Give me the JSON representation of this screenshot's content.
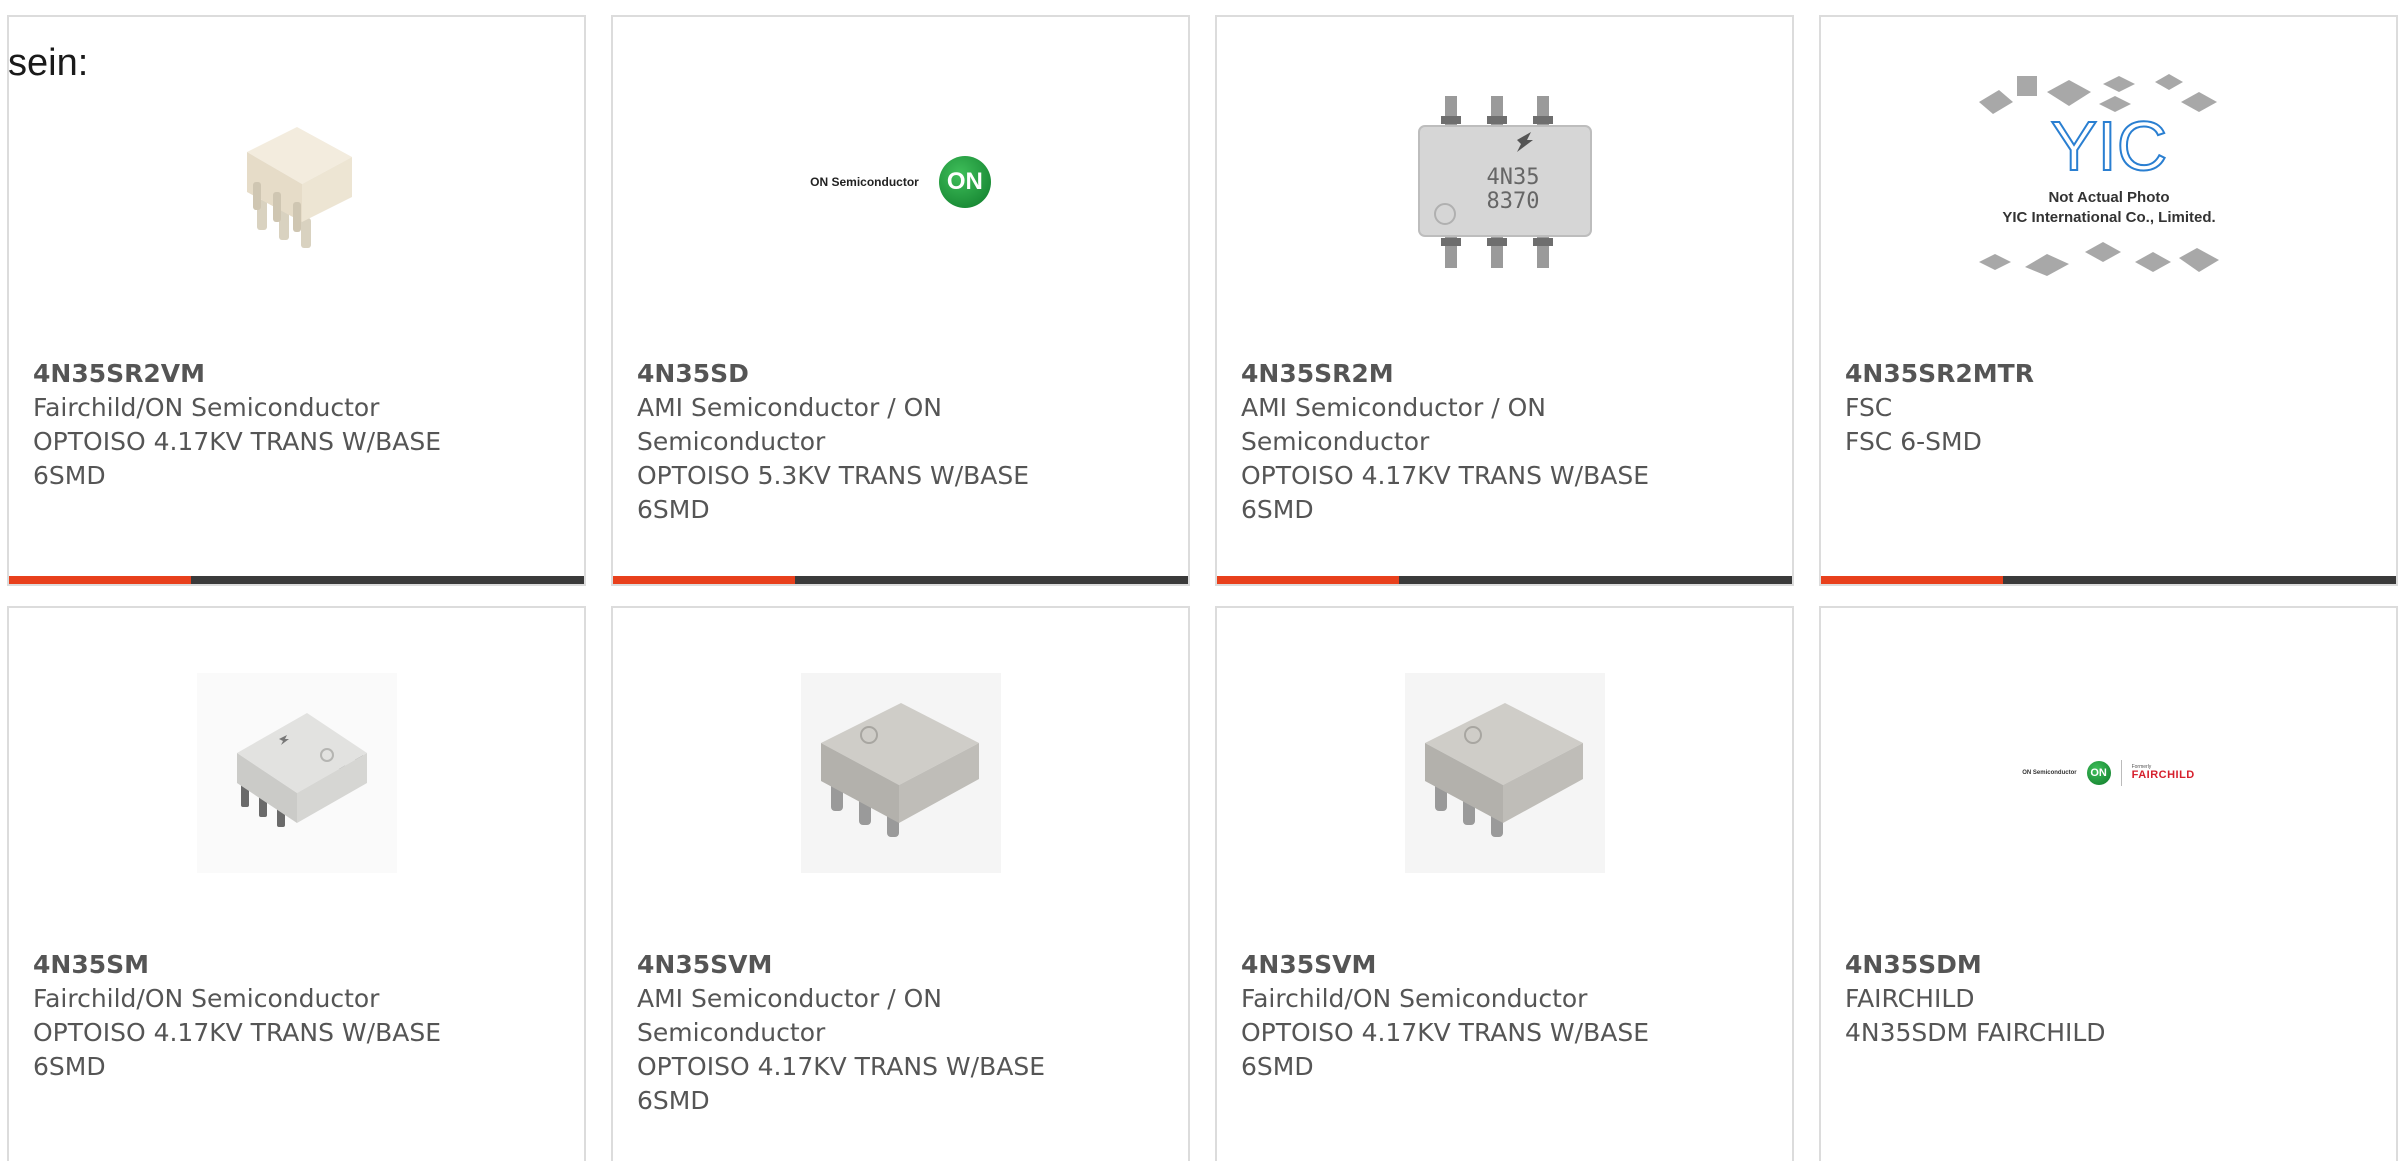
{
  "intro_text": "sein:",
  "colors": {
    "accent": "#e8401c",
    "bar_dark": "#3a3a3a",
    "card_border": "#dcdcdc",
    "text": "#555555"
  },
  "products": [
    {
      "part": "4N35SR2VM",
      "manufacturer": "Fairchild/ON Semiconductor",
      "description": "OPTOISO 4.17KV TRANS W/BASE 6SMD",
      "image": "smd-6pin-cream-chip-image"
    },
    {
      "part": "4N35SD",
      "manufacturer": "AMI Semiconductor / ON Semiconductor",
      "description": "OPTOISO 5.3KV TRANS W/BASE 6SMD",
      "image": "on-semiconductor-logo",
      "logo_text": "ON Semiconductor",
      "logo_badge": "ON"
    },
    {
      "part": "4N35SR2M",
      "manufacturer": "AMI Semiconductor / ON Semiconductor",
      "description": "OPTOISO 4.17KV TRANS W/BASE 6SMD",
      "image": "dip-6pin-chip-image",
      "chip_marking_1": "4N35",
      "chip_marking_2": "8370"
    },
    {
      "part": "4N35SR2MTR",
      "manufacturer": "FSC",
      "description": "FSC 6-SMD",
      "image": "yic-placeholder-image",
      "placeholder_logo": "YIC",
      "placeholder_line1": "Not Actual Photo",
      "placeholder_line2": "YIC International Co., Limited."
    },
    {
      "part": "4N35SM",
      "manufacturer": "Fairchild/ON Semiconductor",
      "description": "OPTOISO 4.17KV TRANS W/BASE 6SMD",
      "image": "smd-6pin-grey-chip-image"
    },
    {
      "part": "4N35SVM",
      "manufacturer": "AMI Semiconductor / ON Semiconductor",
      "description": "OPTOISO 4.17KV TRANS W/BASE 6SMD",
      "image": "smd-6pin-grey-chip-image"
    },
    {
      "part": "4N35SVM",
      "manufacturer": "Fairchild/ON Semiconductor",
      "description": "OPTOISO 4.17KV TRANS W/BASE 6SMD",
      "image": "smd-6pin-grey-chip-image"
    },
    {
      "part": "4N35SDM",
      "manufacturer": "FAIRCHILD",
      "description": "4N35SDM FAIRCHILD",
      "image": "on-fairchild-logo",
      "logo_text": "ON Semiconductor",
      "logo_badge": "ON",
      "brand_formerly": "Formerly",
      "brand_name": "FAIRCHILD"
    }
  ]
}
